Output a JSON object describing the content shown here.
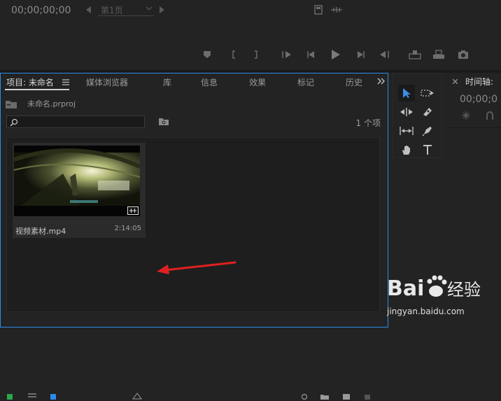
{
  "monitor": {
    "timecode": "00;00;00;00",
    "page_selector": "第1页"
  },
  "project_panel": {
    "tabs": [
      {
        "label": "项目: 未命名"
      },
      {
        "label": "媒体浏览器"
      },
      {
        "label": "库"
      },
      {
        "label": "信息"
      },
      {
        "label": "效果"
      },
      {
        "label": "标记"
      },
      {
        "label": "历史"
      }
    ],
    "project_file": "未命名.prproj",
    "search_placeholder": "",
    "item_count": "1 个项",
    "clip": {
      "name": "视频素材.mp4",
      "duration": "2:14:05"
    }
  },
  "timeline": {
    "tab_label": "时间轴:",
    "timecode": "00;00;0"
  },
  "watermark": {
    "logo_text": "Bai 经验",
    "url": "jingyan.baidu.com"
  },
  "colors": {
    "panel_bg": "#232323",
    "focus_border": "#2d8ceb",
    "arrow": "#e02020",
    "selection_tool": "#3c8ee6"
  }
}
